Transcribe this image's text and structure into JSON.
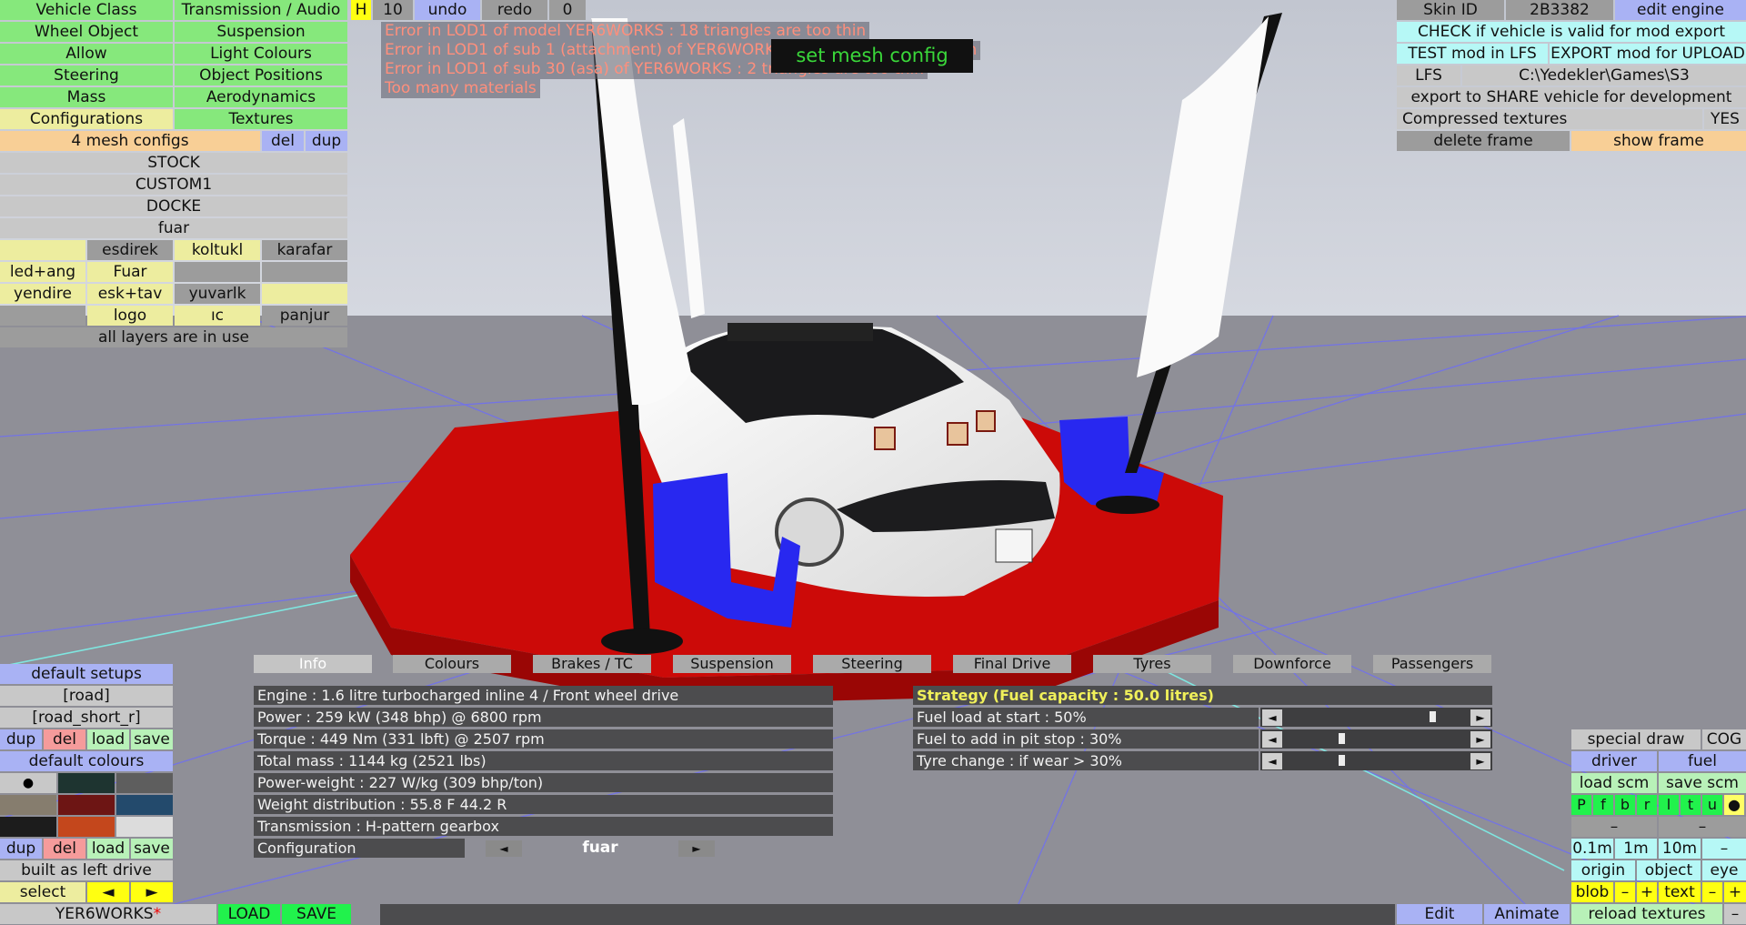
{
  "app": "LFS Vehicle Editor",
  "left_tabs": {
    "vehicle_class": "Vehicle Class",
    "transmission_audio": "Transmission / Audio",
    "wheel_object": "Wheel Object",
    "suspension": "Suspension",
    "allow": "Allow",
    "light_colours": "Light Colours",
    "steering": "Steering",
    "object_positions": "Object Positions",
    "mass": "Mass",
    "aerodynamics": "Aerodynamics",
    "configurations": "Configurations",
    "textures": "Textures"
  },
  "top_bar": {
    "h": "H",
    "count": "10",
    "undo": "undo",
    "redo": "redo",
    "zero": "0"
  },
  "mesh_configs": {
    "label": "4 mesh configs",
    "del": "del",
    "dup": "dup",
    "items": [
      "STOCK",
      "CUSTOM1",
      "DOCKE",
      "fuar"
    ]
  },
  "layers": [
    "",
    "esdirek",
    "koltukl",
    "karafar",
    "led+ang",
    "Fuar",
    "",
    "",
    "yendire",
    "esk+tav",
    "yuvarlk",
    "",
    "",
    "logo",
    "ıc",
    "panjur"
  ],
  "layers_status": "all layers are in use",
  "errors": [
    "Error in LOD1 of model YER6WORKS : 18 triangles are too thin",
    "Error in LOD1 of sub 1 (attachment) of YER6WORKS : 4 triangles are too thin",
    "Error in LOD1 of sub 30 (asa) of YER6WORKS : 2 triangles are too thin",
    "Too many materials"
  ],
  "tooltip": "set mesh config",
  "top_right": {
    "skin_id_label": "Skin ID",
    "skin_id_value": "2B3382",
    "edit_engine": "edit engine",
    "check_valid": "CHECK if vehicle is valid for mod export",
    "test_mod": "TEST mod in LFS",
    "export_mod": "EXPORT mod for UPLOAD",
    "lfs": "LFS",
    "path": "C:\\Yedekler\\Games\\S3",
    "export_share": "export to SHARE vehicle for development",
    "compressed": "Compressed textures",
    "compressed_value": "YES",
    "delete_frame": "delete frame",
    "show_frame": "show frame"
  },
  "bottom_tabs": [
    "Info",
    "Colours",
    "Brakes / TC",
    "Suspension",
    "Steering",
    "Final Drive",
    "Tyres",
    "Downforce",
    "Passengers"
  ],
  "info": [
    "Engine : 1.6 litre turbocharged inline 4 / Front wheel drive",
    "Power : 259 kW (348 bhp) @ 6800 rpm",
    "Torque : 449 Nm (331 lbft) @ 2507 rpm",
    "Total mass : 1144 kg (2521 lbs)",
    "Power-weight : 227 W/kg (309 bhp/ton)",
    "Weight distribution : 55.8 F  44.2 R",
    "Transmission : H-pattern gearbox"
  ],
  "configuration": {
    "label": "Configuration",
    "value": "fuar",
    "prev": "◄",
    "next": "►"
  },
  "strategy": {
    "title": "Strategy (Fuel capacity : 50.0 litres)",
    "rows": [
      {
        "label": "Fuel load at start : 50%",
        "level": 0.8
      },
      {
        "label": "Fuel to add in pit stop : 30%",
        "level": 0.3
      },
      {
        "label": "Tyre change : if wear > 30%",
        "level": 0.3
      }
    ]
  },
  "setups": {
    "default_setups": "default setups",
    "items": [
      "[road]",
      "[road_short_r]"
    ],
    "dup": "dup",
    "del": "del",
    "load": "load",
    "save": "save",
    "default_colours": "default colours",
    "built_as": "built as left drive",
    "select": "select",
    "left": "◄",
    "right": "►",
    "swatches": [
      "#c8c8c8",
      "#1e3430",
      "#5e5e5e",
      "#867d6e",
      "#6d1514",
      "#234a6c",
      "#1c1c1c",
      "#c4471c",
      "#dcdcdc"
    ],
    "swatch_dot": "●"
  },
  "bottom_bar": {
    "name": "YER6WORKS",
    "star": "*",
    "load": "LOAD",
    "save": "SAVE",
    "edit": "Edit",
    "animate": "Animate",
    "reload": "reload textures",
    "minus": "–"
  },
  "bottom_right": {
    "special_draw": "special draw",
    "cog": "COG",
    "driver": "driver",
    "fuel": "fuel",
    "load_scm": "load scm",
    "save_scm": "save scm",
    "letters": [
      "P",
      "f",
      "b",
      "r",
      "l",
      "t",
      "u",
      "●"
    ],
    "dash1": "–",
    "dash2": "–",
    "steps": [
      "0.1m",
      "1m",
      "10m",
      "–"
    ],
    "origin": "origin",
    "object": "object",
    "eye": "eye",
    "blob": "blob",
    "minus": "–",
    "plus": "+",
    "text": "text"
  },
  "colors": {
    "red_carpet": "#cc0a08",
    "car_body": "#f2f2f2",
    "ground": "#8f8f97",
    "sky": "#c9cdd6"
  }
}
